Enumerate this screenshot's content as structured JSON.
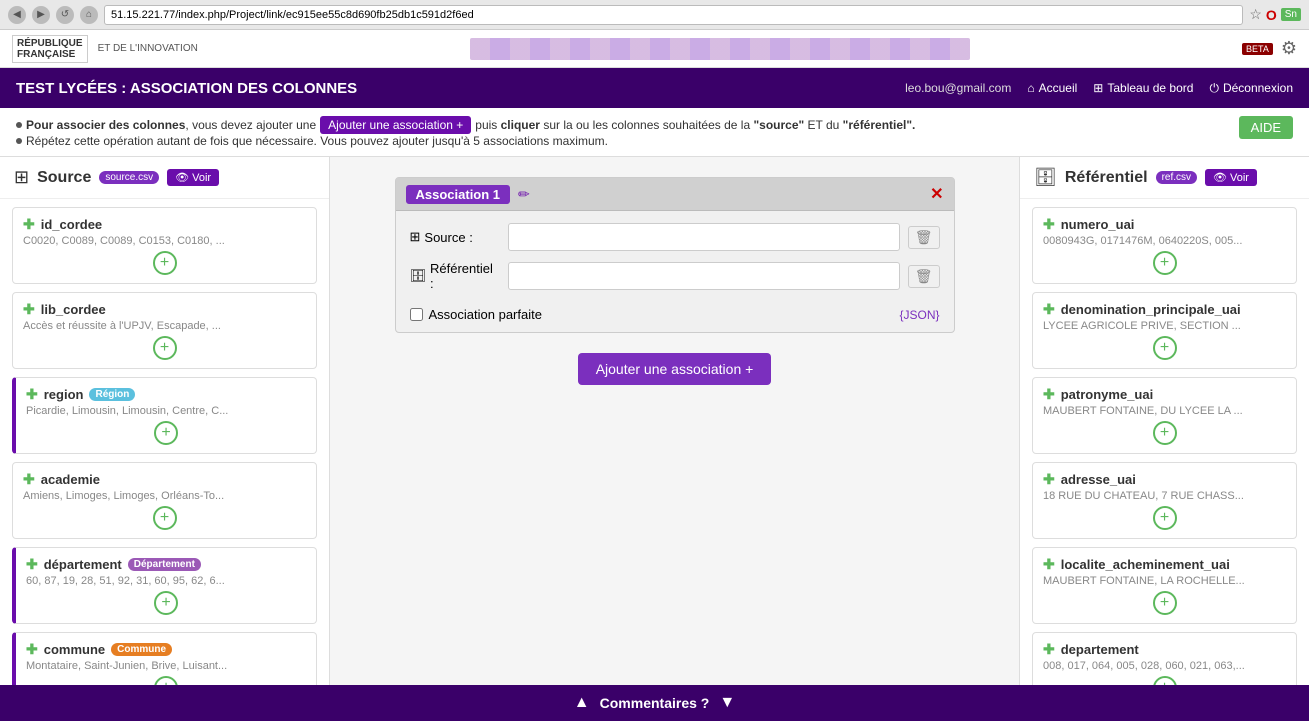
{
  "browser": {
    "url": "51.15.221.77/index.php/Project/link/ec915ee55c8d690fb25db1c591d2f6ed",
    "nav_back": "◀",
    "nav_forward": "▶",
    "nav_refresh": "↺",
    "nav_home": "⌂"
  },
  "header": {
    "title": "TEST LYCÉES : ASSOCIATION DES COLONNES",
    "user_email": "leo.bou@gmail.com",
    "accueil_label": "Accueil",
    "tableau_label": "Tableau de bord",
    "deconnexion_label": "Déconnexion"
  },
  "info_bar": {
    "line1_before": "Pour associer des colonnes",
    "line1_btn": "Ajouter une association +",
    "line1_after": "puis cliquer sur la ou les colonnes souhaitées de la",
    "line1_source": "\"source\"",
    "line1_et": "ET du",
    "line1_ref": "\"référentiel\".",
    "line2": "Répétez cette opération autant de fois que nécessaire. Vous pouvez ajouter jusqu'à 5 associations maximum.",
    "aide_label": "AIDE"
  },
  "source_panel": {
    "icon": "⊞",
    "title": "Source",
    "file_badge": "source.csv",
    "voir_label": "Voir",
    "voir_icon": "👁",
    "columns": [
      {
        "name": "id_cordee",
        "preview": "C0020, C0089, C0089, C0153, C0180, ...",
        "tagged": false,
        "tag": null
      },
      {
        "name": "lib_cordee",
        "preview": "Accès et réussite à l'UPJV, Escapade, ...",
        "tagged": false,
        "tag": null
      },
      {
        "name": "region",
        "preview": "Picardie, Limousin, Limousin, Centre, C...",
        "tagged": true,
        "tag": "Région",
        "tag_class": "tag-region"
      },
      {
        "name": "academie",
        "preview": "Amiens, Limoges, Limoges, Orléans-To...",
        "tagged": false,
        "tag": null
      },
      {
        "name": "département",
        "preview": "60, 87, 19, 28, 51, 92, 31, 60, 95, 62, 6...",
        "tagged": true,
        "tag": "Département",
        "tag_class": "tag-dept"
      },
      {
        "name": "commune",
        "preview": "Montataire, Saint-Junien, Brive, Luisant...",
        "tagged": true,
        "tag": "Commune",
        "tag_class": "tag-commune"
      }
    ]
  },
  "association": {
    "title": "Association 1",
    "source_label": "Source :",
    "source_icon": "⊞",
    "ref_label": "Référentiel :",
    "ref_icon": "🗄",
    "source_value": "",
    "ref_value": "",
    "assoc_parfaite_label": "Association parfaite",
    "json_label": "{JSON}",
    "add_btn": "Ajouter une association +"
  },
  "ref_panel": {
    "icon": "🗄",
    "title": "Référentiel",
    "file_badge": "ref.csv",
    "voir_label": "Voir",
    "voir_icon": "👁",
    "columns": [
      {
        "name": "numero_uai",
        "preview": "0080943G, 0171476M, 0640220S, 005..."
      },
      {
        "name": "denomination_principale_uai",
        "preview": "LYCEE AGRICOLE PRIVE, SECTION ..."
      },
      {
        "name": "patronyme_uai",
        "preview": "MAUBERT FONTAINE, DU LYCEE LA ..."
      },
      {
        "name": "adresse_uai",
        "preview": "18 RUE DU CHATEAU, 7 RUE CHASS..."
      },
      {
        "name": "localite_acheminement_uai",
        "preview": "MAUBERT FONTAINE, LA ROCHELLE..."
      },
      {
        "name": "departement",
        "preview": "008, 017, 064, 005, 028, 060, 021, 063,..."
      }
    ]
  },
  "comments_bar": {
    "label": "Commentaires ?",
    "arrow_up": "▲",
    "arrow_down": "▼"
  }
}
